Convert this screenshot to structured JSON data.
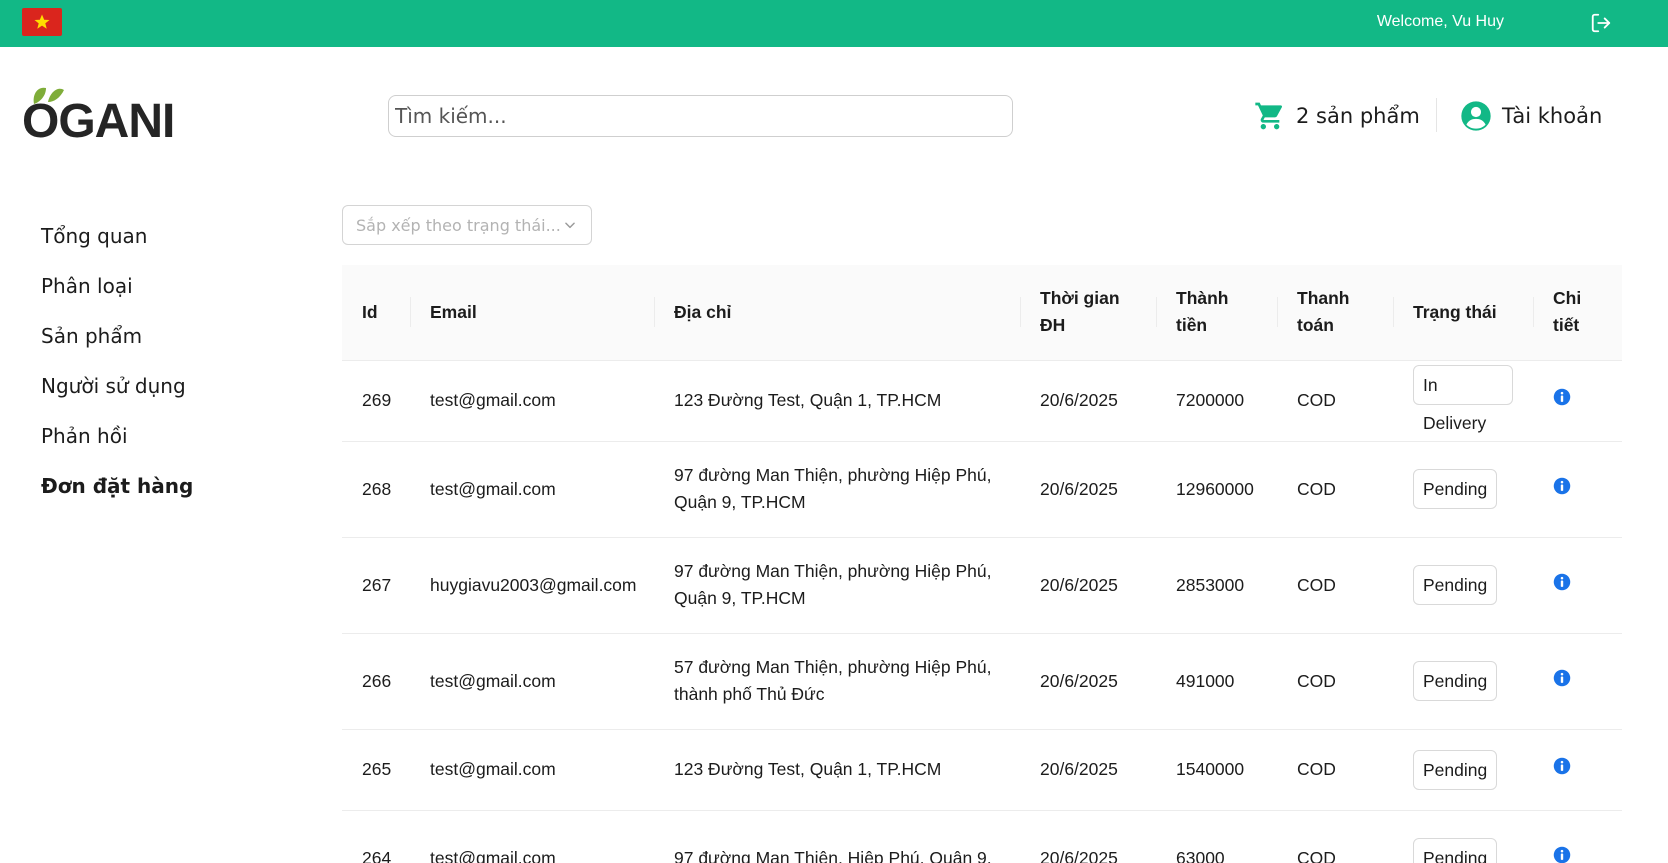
{
  "topbar": {
    "welcome": "Welcome, Vu Huy",
    "flag": "vietnam-flag",
    "logout_icon": "logout-icon"
  },
  "logo": {
    "text": "OGANI"
  },
  "search": {
    "placeholder": "Tìm kiếm..."
  },
  "cart": {
    "label": "2 sản phẩm",
    "icon": "cart-icon"
  },
  "account": {
    "label": "Tài khoản",
    "icon": "user-icon"
  },
  "sidebar": {
    "items": [
      {
        "label": "Tổng quan",
        "active": false
      },
      {
        "label": "Phân loại",
        "active": false
      },
      {
        "label": "Sản phẩm",
        "active": false
      },
      {
        "label": "Người sử dụng",
        "active": false
      },
      {
        "label": "Phản hồi",
        "active": false
      },
      {
        "label": "Đơn đặt hàng",
        "active": true
      }
    ]
  },
  "sort": {
    "placeholder": "Sắp xếp theo trạng thái..."
  },
  "table": {
    "headers": [
      "Id",
      "Email",
      "Địa chỉ",
      "Thời gian ĐH",
      "Thành tiền",
      "Thanh toán",
      "Trạng thái",
      "Chi tiết"
    ],
    "rows": [
      {
        "id": "269",
        "email": "test@gmail.com",
        "address": "123 Đường Test, Quận 1, TP.HCM",
        "date": "20/6/2025",
        "total": "7200000",
        "payment": "COD",
        "status": "In Delivery"
      },
      {
        "id": "268",
        "email": "test@gmail.com",
        "address": "97 đường Man Thiện, phường Hiệp Phú, Quận 9, TP.HCM",
        "date": "20/6/2025",
        "total": "12960000",
        "payment": "COD",
        "status": "Pending"
      },
      {
        "id": "267",
        "email": "huygiavu2003@gmail.com",
        "address": "97 đường Man Thiện, phường Hiệp Phú, Quận 9, TP.HCM",
        "date": "20/6/2025",
        "total": "2853000",
        "payment": "COD",
        "status": "Pending"
      },
      {
        "id": "266",
        "email": "test@gmail.com",
        "address": "57 đường Man Thiện, phường Hiệp Phú, thành phố Thủ Đức",
        "date": "20/6/2025",
        "total": "491000",
        "payment": "COD",
        "status": "Pending"
      },
      {
        "id": "265",
        "email": "test@gmail.com",
        "address": "123 Đường Test, Quận 1, TP.HCM",
        "date": "20/6/2025",
        "total": "1540000",
        "payment": "COD",
        "status": "Pending"
      },
      {
        "id": "264",
        "email": "test@gmail.com",
        "address": "97 đường Man Thiện, Hiệp Phú, Quận 9,",
        "date": "20/6/2025",
        "total": "63000",
        "payment": "COD",
        "status": "Pending"
      }
    ]
  },
  "colors": {
    "brand": "#12b886",
    "info": "#1a73e8",
    "flag_red": "#da251d",
    "flag_star": "#ffdd00"
  }
}
